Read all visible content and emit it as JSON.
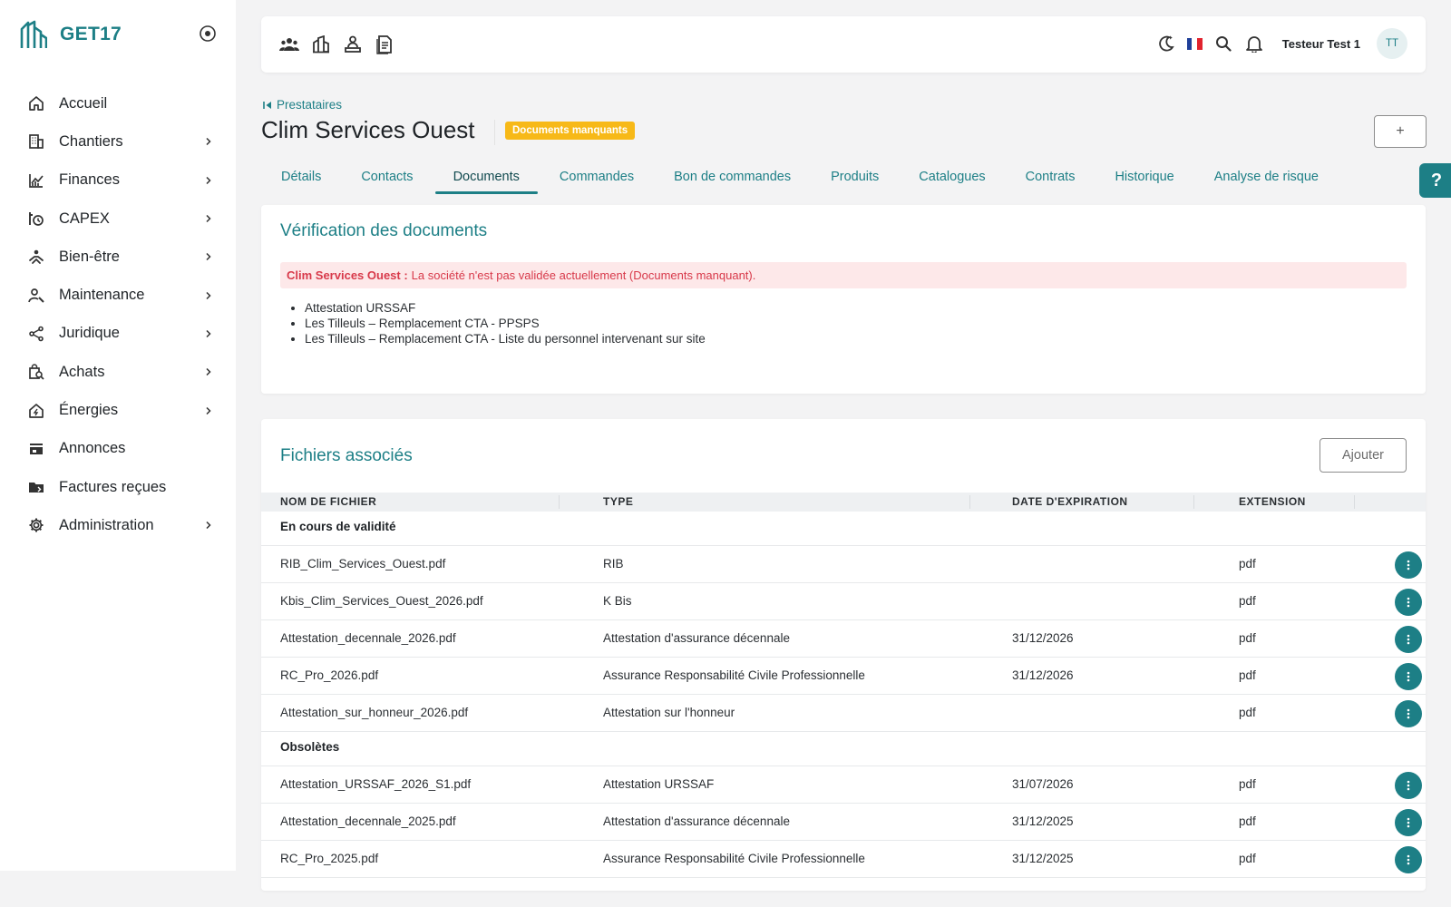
{
  "app": {
    "logo_text": "GET17"
  },
  "sidebar": {
    "items": [
      {
        "label": "Accueil",
        "icon": "home-icon",
        "has_submenu": false
      },
      {
        "label": "Chantiers",
        "icon": "building-icon",
        "has_submenu": true
      },
      {
        "label": "Finances",
        "icon": "finance-chart-icon",
        "has_submenu": true
      },
      {
        "label": "CAPEX",
        "icon": "capex-icon",
        "has_submenu": true
      },
      {
        "label": "Bien-être",
        "icon": "wellbeing-icon",
        "has_submenu": true
      },
      {
        "label": "Maintenance",
        "icon": "maintenance-icon",
        "has_submenu": true
      },
      {
        "label": "Juridique",
        "icon": "share-icon",
        "has_submenu": true
      },
      {
        "label": "Achats",
        "icon": "purchase-icon",
        "has_submenu": true
      },
      {
        "label": "Énergies",
        "icon": "energy-home-icon",
        "has_submenu": true
      },
      {
        "label": "Annonces",
        "icon": "store-icon",
        "has_submenu": false
      },
      {
        "label": "Factures reçues",
        "icon": "folder-icon",
        "has_submenu": false
      },
      {
        "label": "Administration",
        "icon": "gear-icon",
        "has_submenu": true
      }
    ]
  },
  "topbar": {
    "icons": [
      "users-icon",
      "buildings-icon",
      "person-desk-icon",
      "document-icon"
    ],
    "user_name": "Testeur Test 1",
    "avatar_initials": "TT"
  },
  "header": {
    "breadcrumb": "Prestataires",
    "title": "Clim Services Ouest",
    "badge": "Documents manquants",
    "plus_label": "+"
  },
  "tabs": [
    {
      "label": "Détails",
      "active": false
    },
    {
      "label": "Contacts",
      "active": false
    },
    {
      "label": "Documents",
      "active": true
    },
    {
      "label": "Commandes",
      "active": false
    },
    {
      "label": "Bon de commandes",
      "active": false
    },
    {
      "label": "Produits",
      "active": false
    },
    {
      "label": "Catalogues",
      "active": false
    },
    {
      "label": "Contrats",
      "active": false
    },
    {
      "label": "Historique",
      "active": false
    },
    {
      "label": "Analyse de risque",
      "active": false
    }
  ],
  "help_label": "?",
  "verification": {
    "title": "Vérification des documents",
    "alert_company": "Clim Services Ouest :",
    "alert_message": "La société n'est pas validée actuellement (Documents manquant).",
    "missing": [
      "Attestation URSSAF",
      "Les Tilleuls – Remplacement CTA - PPSPS",
      "Les Tilleuls – Remplacement CTA - Liste du personnel intervenant sur site"
    ]
  },
  "files": {
    "title": "Fichiers associés",
    "add_label": "Ajouter",
    "columns": [
      "NOM DE FICHIER",
      "TYPE",
      "DATE D'EXPIRATION",
      "EXTENSION"
    ],
    "groups": [
      {
        "label": "En cours de validité",
        "rows": [
          {
            "name": "RIB_Clim_Services_Ouest.pdf",
            "type": "RIB",
            "expiry": "",
            "ext": "pdf"
          },
          {
            "name": "Kbis_Clim_Services_Ouest_2026.pdf",
            "type": "K Bis",
            "expiry": "",
            "ext": "pdf"
          },
          {
            "name": "Attestation_decennale_2026.pdf",
            "type": "Attestation d'assurance décennale",
            "expiry": "31/12/2026",
            "ext": "pdf"
          },
          {
            "name": "RC_Pro_2026.pdf",
            "type": "Assurance Responsabilité Civile Professionnelle",
            "expiry": "31/12/2026",
            "ext": "pdf"
          },
          {
            "name": "Attestation_sur_honneur_2026.pdf",
            "type": "Attestation sur l'honneur",
            "expiry": "",
            "ext": "pdf"
          }
        ]
      },
      {
        "label": "Obsolètes",
        "rows": [
          {
            "name": "Attestation_URSSAF_2026_S1.pdf",
            "type": "Attestation URSSAF",
            "expiry": "31/07/2026",
            "ext": "pdf"
          },
          {
            "name": "Attestation_decennale_2025.pdf",
            "type": "Attestation d'assurance décennale",
            "expiry": "31/12/2025",
            "ext": "pdf"
          },
          {
            "name": "RC_Pro_2025.pdf",
            "type": "Assurance Responsabilité Civile Professionnelle",
            "expiry": "31/12/2025",
            "ext": "pdf"
          }
        ]
      }
    ]
  },
  "colors": {
    "accent": "#1d7f86",
    "badge": "#f7b918",
    "alert_bg": "#fde8e9",
    "alert_text": "#d8394a"
  }
}
